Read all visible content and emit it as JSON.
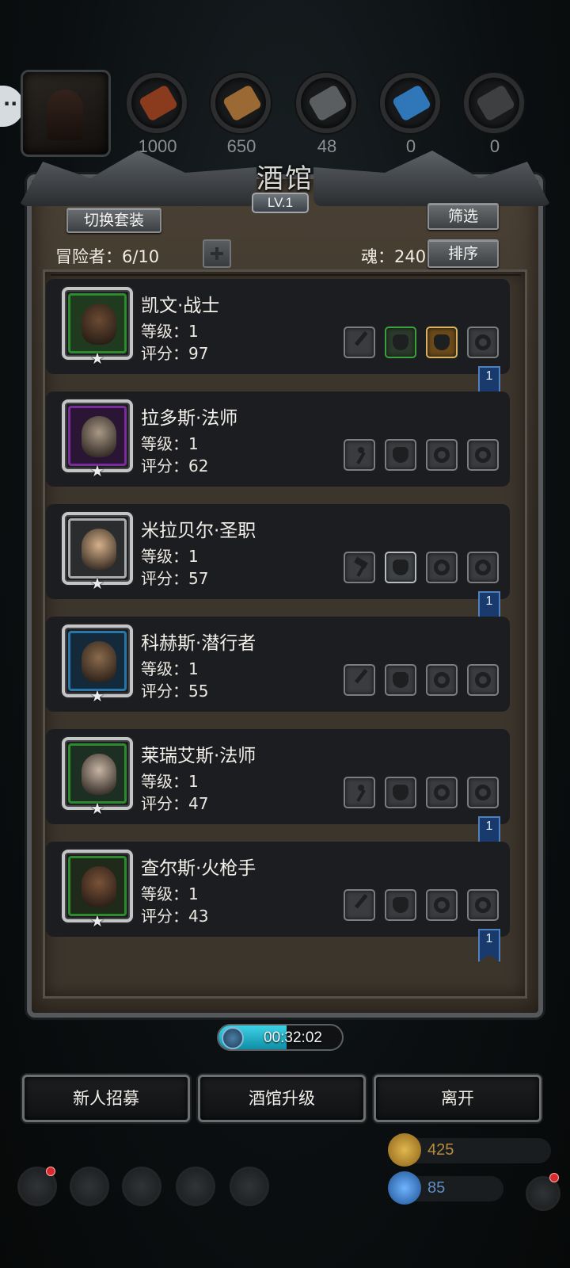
{
  "resources": [
    {
      "name": "meat",
      "value": "1000",
      "icon": "meat-icon",
      "color": "#8a3b1d"
    },
    {
      "name": "wood",
      "value": "650",
      "icon": "wood-icon",
      "color": "#9b6a34"
    },
    {
      "name": "iron",
      "value": "48",
      "icon": "iron-icon",
      "color": "#5b5e60"
    },
    {
      "name": "crystal",
      "value": "0",
      "icon": "crystal-icon",
      "color": "#2f77b8"
    },
    {
      "name": "steel",
      "value": "0",
      "icon": "steel-icon",
      "color": "#3d3f41"
    }
  ],
  "panel": {
    "title": "酒馆",
    "level": "LV.1",
    "switch_set_label": "切换套装",
    "filter_label": "筛选",
    "sort_label": "排序",
    "adventurers_text": "冒险者：6/10",
    "soul_text": "魂：240"
  },
  "heroes": [
    {
      "name": "凯文·战士",
      "level": "等级：1",
      "score": "评分：97",
      "frame": "#2e8a2f",
      "bg": "#1f3a1f",
      "face": "#6b4a33",
      "slots": [
        "blade",
        "armor-green",
        "chest-gold",
        "ring"
      ],
      "bookmark": "1"
    },
    {
      "name": "拉多斯·法师",
      "level": "等级：1",
      "score": "评分：62",
      "frame": "#7a2d9a",
      "bg": "#2a1535",
      "face": "#a89886",
      "slots": [
        "staff",
        "armor",
        "ring",
        "ring"
      ],
      "bookmark": null
    },
    {
      "name": "米拉贝尔·圣职",
      "level": "等级：1",
      "score": "评分：57",
      "frame": "#a8aaab",
      "bg": "#2a2c2e",
      "face": "#d6b08a",
      "slots": [
        "hammer",
        "armor-steel",
        "ring",
        "ring"
      ],
      "bookmark": "1"
    },
    {
      "name": "科赫斯·潜行者",
      "level": "等级：1",
      "score": "评分：55",
      "frame": "#2b76a8",
      "bg": "#14293a",
      "face": "#8b6a4c",
      "slots": [
        "blade",
        "armor",
        "ring",
        "ring"
      ],
      "bookmark": null
    },
    {
      "name": "莱瑞艾斯·法师",
      "level": "等级：1",
      "score": "评分：47",
      "frame": "#2e8a2f",
      "bg": "#1d2e22",
      "face": "#c7b5a5",
      "slots": [
        "staff",
        "armor",
        "ring",
        "ring"
      ],
      "bookmark": "1"
    },
    {
      "name": "查尔斯·火枪手",
      "level": "等级：1",
      "score": "评分：43",
      "frame": "#2e8a2f",
      "bg": "#1f2a1a",
      "face": "#7a5238",
      "slots": [
        "blade",
        "armor",
        "ring",
        "ring"
      ],
      "bookmark": "1"
    }
  ],
  "timer": {
    "text": "00:32:02",
    "progress": 0.55
  },
  "buttons": {
    "recruit": "新人招募",
    "upgrade": "酒馆升级",
    "leave": "离开"
  },
  "currency": {
    "gold": "425",
    "gem": "85"
  },
  "colors": {
    "accent_cyan": "#3dd2e6",
    "bookmark_blue": "#183a6c"
  }
}
